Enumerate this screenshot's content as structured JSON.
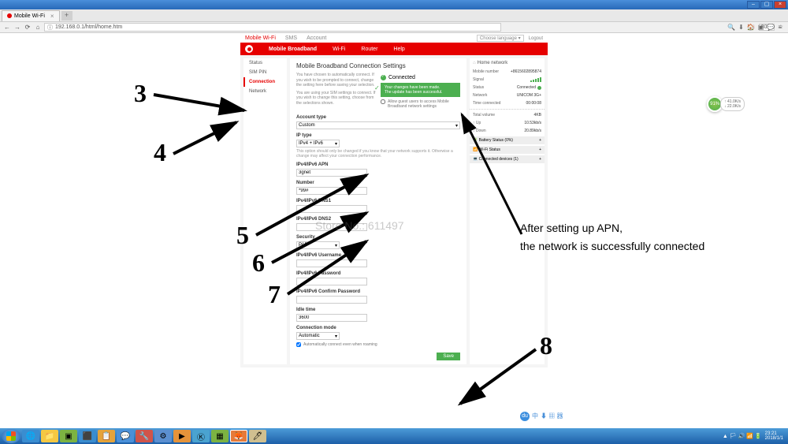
{
  "window": {
    "title": "Mobile Wi-Fi"
  },
  "browser": {
    "tab_title": "Mobile Wi-Fi",
    "url": "192.168.0.1/html/home.htm",
    "zoom": "80%"
  },
  "top_tabs": {
    "mobile_wifi": "Mobile Wi-Fi",
    "sms": "SMS",
    "account": "Account"
  },
  "lang": {
    "choose": "Choose language",
    "logout": "Logout"
  },
  "nav": {
    "mobile_broadband": "Mobile Broadband",
    "wifi": "Wi-Fi",
    "router": "Router",
    "help": "Help"
  },
  "sidebar": {
    "status": "Status",
    "sim_pin": "SIM PIN",
    "connection": "Connection",
    "network": "Network"
  },
  "settings": {
    "title": "Mobile Broadband Connection Settings",
    "desc1": "You have chosen to automatically connect. If you wish to be prompted to connect, change the setting here before saving your selection.",
    "desc2": "You are using your SIM settings to connect. If you wish to change this setting, choose from the selections shown.",
    "connected": "Connected",
    "success1": "Your changes have been made.",
    "success2": "The update has been successful.",
    "guest_check": "Allow guest users to access Mobile Broadband network settings",
    "account_type": "Account type",
    "account_type_val": "Custom",
    "ip_type": "IP type",
    "ip_type_val": "IPv4 + IPv6",
    "ip_hint": "This option should only be changed if you know that your network supports it. Otherwise a change may affect your connection performance.",
    "apn": "IPv4/IPv6 APN",
    "apn_val": "3gnet",
    "number": "Number",
    "number_val": "*99#",
    "dns1": "IPv4/IPv6 DNS1",
    "dns2": "IPv4/IPv6 DNS2",
    "security": "Security",
    "security_val": "PAP",
    "username": "IPv4/IPv6 Username",
    "password": "IPv4/IPv6 Password",
    "confirm_pw": "IPv4/IPv6 Confirm Password",
    "idle_time": "Idle time",
    "idle_time_val": "3600",
    "conn_mode": "Connection mode",
    "conn_mode_val": "Automatic",
    "roaming_check": "Automatically connect even when roaming",
    "save": "Save"
  },
  "status_panel": {
    "header": "Home network",
    "mobile_number": "Mobile number",
    "mobile_number_val": "+8615602895874",
    "signal": "Signal",
    "status": "Status",
    "status_val": "Connected",
    "network": "Network",
    "network_val": "UNICOM 3G+",
    "time_connected": "Time connected",
    "time_connected_val": "00:00:08",
    "total_volume": "Total volume",
    "total_volume_val": "4KB",
    "up": "↑ Up",
    "up_val": "10.53kb/s",
    "down": "↓ Down",
    "down_val": "20.89kb/s",
    "battery": "Battery Status (0%)",
    "wifi_status": "Wi-Fi Status",
    "connected_devices": "Connected devices (1)"
  },
  "annotations": {
    "n3": "3",
    "n4": "4",
    "n5": "5",
    "n6": "6",
    "n7": "7",
    "n8": "8",
    "text1": "After setting up APN,",
    "text2": "the network is successfully connected"
  },
  "watermark": "Store No.: 611497",
  "widget": {
    "pct": "91%",
    "up": "↑ 41.0K/s",
    "down": "↓ 22.0K/s"
  },
  "badges": {
    "du": "du",
    "zh": "中",
    "items": "⬇ ▦ 器"
  },
  "tray": {
    "time": "23:21",
    "date": "2018/1/1"
  }
}
